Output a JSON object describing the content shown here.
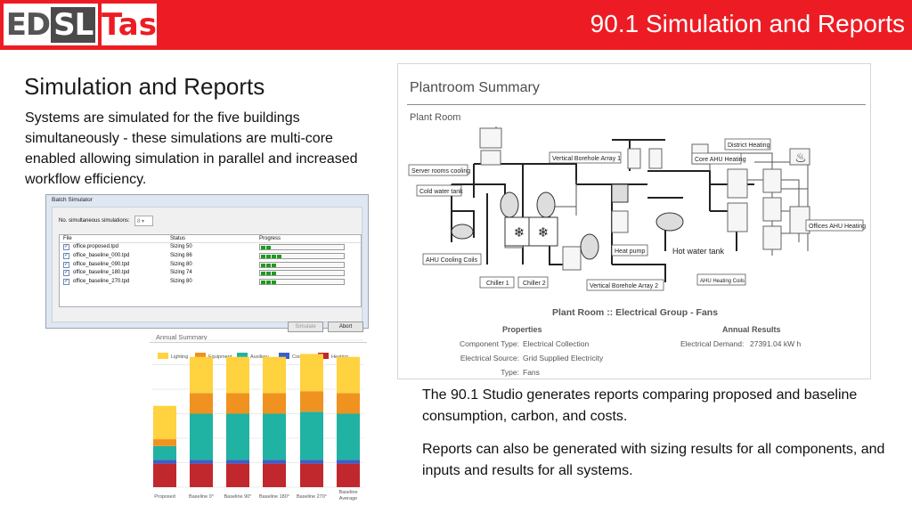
{
  "header": {
    "logo_left": "ED",
    "logo_mid": "SL",
    "logo_right": "Tas",
    "title": "90.1 Simulation and Reports",
    "background": "#ed1c24"
  },
  "left": {
    "title": "Simulation and Reports",
    "body": "Systems are simulated for the five buildings simultaneously - these simulations are multi-core enabled allowing simulation in parallel and increased workflow efficiency."
  },
  "batch_simulator": {
    "title": "Batch Simulator",
    "label": "No. simultaneous simulations:",
    "select_value": "8",
    "columns": [
      "File",
      "Status",
      "Progress"
    ],
    "rows": [
      {
        "file": "office.proposed.tpd",
        "status": "Sizing 50",
        "progress": 2
      },
      {
        "file": "office_baseline_000.tpd",
        "status": "Sizing 86",
        "progress": 4
      },
      {
        "file": "office_baseline_090.tpd",
        "status": "Sizing 80",
        "progress": 3
      },
      {
        "file": "office_baseline_180.tpd",
        "status": "Sizing 74",
        "progress": 3
      },
      {
        "file": "office_baseline_270.tpd",
        "status": "Sizing 80",
        "progress": 3
      }
    ],
    "buttons": {
      "simulate": "Simulate",
      "abort": "Abort"
    }
  },
  "chart_data": {
    "type": "bar",
    "title": "Annual Summary",
    "legend": [
      "Lighting",
      "Equipment",
      "Auxiliary",
      "Cooling",
      "Heating"
    ],
    "colors": [
      "#ffd23f",
      "#f0921f",
      "#20b2a2",
      "#3b5fc9",
      "#c0282d"
    ],
    "categories": [
      "Proposed",
      "Baseline 0°",
      "Baseline 90°",
      "Baseline 180°",
      "Baseline 270°",
      "Baseline Average"
    ],
    "series": [
      {
        "name": "Heating",
        "values": [
          24,
          24,
          24,
          24,
          24,
          24
        ]
      },
      {
        "name": "Cooling",
        "values": [
          4,
          4,
          4,
          4,
          4,
          4
        ]
      },
      {
        "name": "Auxiliary",
        "values": [
          14,
          47,
          47,
          47,
          49,
          47
        ]
      },
      {
        "name": "Equipment",
        "values": [
          7,
          21,
          21,
          21,
          21,
          21
        ]
      },
      {
        "name": "Lighting",
        "values": [
          34,
          37,
          37,
          37,
          38,
          37
        ]
      }
    ]
  },
  "plantroom": {
    "title": "Plantroom Summary",
    "subtitle": "Plant Room",
    "labels": {
      "district_heating": "District Heating",
      "server_rooms": "Server rooms cooling",
      "vertical_borehole_1": "Vertical Borehole Array 1",
      "core_ahu": "Core AHU Heating",
      "cold_water": "Cold water tank",
      "offices_ahu": "Offices AHU Heating",
      "heat_pump": "Heat pump",
      "hot_water": "Hot water tank",
      "ahu_cooling": "AHU Cooling Coils",
      "chiller1": "Chiller 1",
      "chiller2": "Chiller 2",
      "vertical_borehole_2": "Vertical Borehole Array 2",
      "ahu_heating": "AHU Heating Coils"
    },
    "group_title": "Plant Room :: Electrical Group - Fans",
    "properties_heading": "Properties",
    "annual_heading": "Annual Results",
    "properties": [
      {
        "label": "Component Type:",
        "value": "Electrical Collection"
      },
      {
        "label": "Electrical Source:",
        "value": "Grid Supplied Electricity"
      },
      {
        "label": "Type:",
        "value": "Fans"
      }
    ],
    "annual": {
      "label": "Electrical Demand:",
      "value": "27391.04 kW h"
    }
  },
  "right": {
    "p1": "The 90.1 Studio generates reports comparing proposed and baseline consumption, carbon, and costs.",
    "p2": "Reports can also be generated with sizing results for all components, and inputs and results for all systems."
  }
}
